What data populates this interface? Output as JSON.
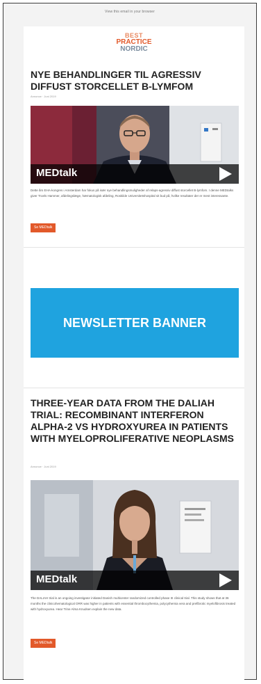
{
  "header": {
    "view_in_browser": "View this email in your browser"
  },
  "logo": {
    "line1": "BEST",
    "line2": "PRACTICE",
    "line3": "NORDIC"
  },
  "articles": [
    {
      "title": "NYE BEHANDLINGER TIL AGRESSIV DIFFUST STORCELLET B-LYMFOM",
      "meta": "Annonce · Juni 2019",
      "video_label": "MEDtalk",
      "body": "Dette års EHA-kongres i Amsterdam har fokus på især nye behandlingsmuligheder af relaps-agressiv diffust storcellet B-lymfom. I denne MEDtalks giver Troels Hammer, afdelingslæge, hæmatologisk afdeling, Roskilde Universitetshospital sit bud på, hvilke resultater der er mest interessante.",
      "button": "Se MEDtalk"
    },
    {
      "title": "THREE-YEAR DATA FROM THE DALIAH TRIAL: RECOMBINANT INTERFERON ALPHA-2 VS HYDROXYUREA IN PATIENTS WITH MYELOPROLIFERATIVE NEOPLASMS",
      "meta": "Annonce · Juni 2019",
      "video_label": "MEDtalk",
      "body": "The DALIAH trial is an ongoing investigator initiated Danish multicenter randomized controlled phase III clinical trial. This study shows that at 36 months the clinicohematological ORR was higher in patients with essential thrombocythemia, polycythemia vera and prefibrotic myelofibrosis treated with hydroxyurea. Hear Trine Alma Knudsen explain the new data.",
      "button": "Se MEDtalk"
    }
  ],
  "banner": {
    "text": "NEWSLETTER BANNER"
  },
  "colors": {
    "accent": "#e2592a",
    "banner": "#1fa3df",
    "title": "#222222"
  }
}
